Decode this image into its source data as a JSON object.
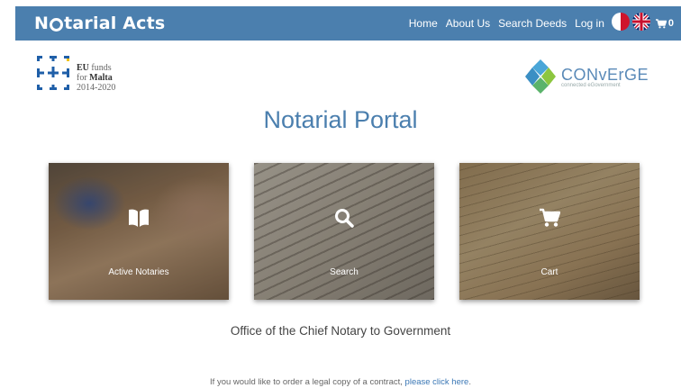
{
  "navbar": {
    "brand_prefix": "N",
    "brand_suffix": "tarial Acts",
    "links": [
      "Home",
      "About Us",
      "Search Deeds",
      "Log in"
    ],
    "cart_count": "0"
  },
  "logos": {
    "eu_line1": "EU",
    "eu_line1b": "funds",
    "eu_line2a": "for",
    "eu_line2b": "Malta",
    "eu_line3": "2014-2020",
    "converge_name": "CONvErGE",
    "converge_sub": "connected eGovernment"
  },
  "page_title": "Notarial Portal",
  "cards": [
    {
      "label": "Active Notaries",
      "icon": "book-icon"
    },
    {
      "label": "Search",
      "icon": "search-icon"
    },
    {
      "label": "Cart",
      "icon": "cart-icon"
    }
  ],
  "office_text": "Office of the Chief Notary to Government",
  "footer": {
    "text": "If you would like to order a legal copy of a contract, ",
    "link": "please click here",
    "end": "."
  },
  "colors": {
    "navbar": "#4b7fae",
    "title": "#4b7fae",
    "link": "#3a77b5"
  }
}
